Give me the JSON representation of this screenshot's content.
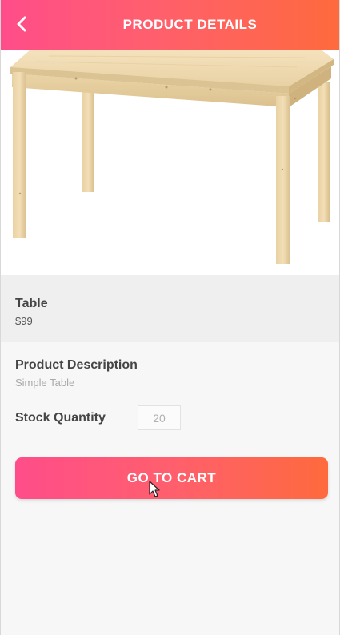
{
  "header": {
    "title": "PRODUCT DETAILS",
    "back_icon": "chevron-left-icon"
  },
  "product": {
    "image": "table-photo",
    "name": "Table",
    "price": "$99",
    "description_label": "Product Description",
    "description": "Simple Table",
    "stock_label": "Stock Quantity",
    "stock_value": "20"
  },
  "actions": {
    "cart_button_label": "GO TO CART"
  },
  "colors": {
    "gradient_start": "#ff4d8a",
    "gradient_end": "#ff6a3d",
    "label_text": "#454545",
    "muted_text": "#a8a8a8"
  }
}
